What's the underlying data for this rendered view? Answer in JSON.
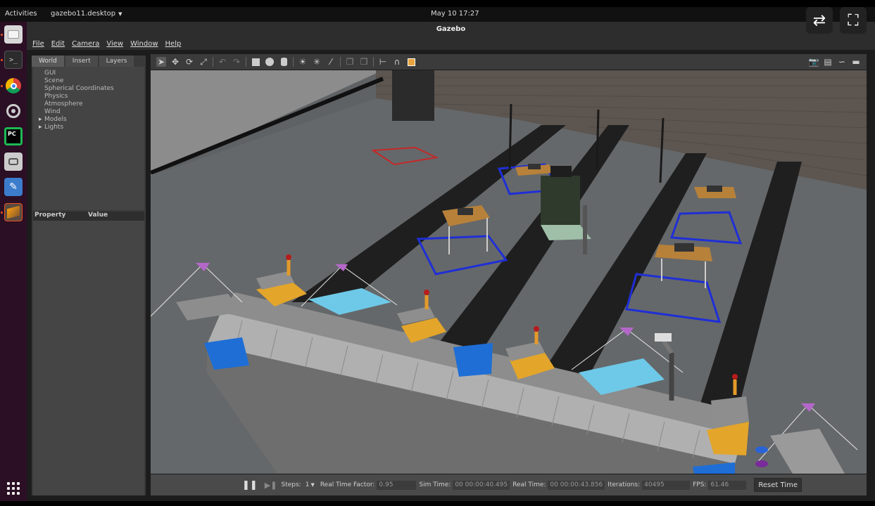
{
  "topbar": {
    "activities": "Activities",
    "app_menu": "gazebo11.desktop",
    "clock": "May 10  17:27"
  },
  "window": {
    "title": "Gazebo"
  },
  "menu": {
    "items": [
      "File",
      "Edit",
      "Camera",
      "View",
      "Window",
      "Help"
    ]
  },
  "left_panel": {
    "tabs": [
      "World",
      "Insert",
      "Layers"
    ],
    "active_tab": "World",
    "tree": [
      "GUI",
      "Scene",
      "Spherical Coordinates",
      "Physics",
      "Atmosphere",
      "Wind",
      "Models",
      "Lights"
    ],
    "property_header": "Property",
    "value_header": "Value"
  },
  "bottombar": {
    "steps_label": "Steps:",
    "steps_value": "1",
    "rtf_label": "Real Time Factor:",
    "rtf_value": "0.95",
    "sim_time_label": "Sim Time:",
    "sim_time_value": "00 00:00:40.495",
    "real_time_label": "Real Time:",
    "real_time_value": "00 00:00:43.856",
    "iterations_label": "Iterations:",
    "iterations_value": "40495",
    "fps_label": "FPS:",
    "fps_value": "61.46",
    "reset_label": "Reset Time"
  },
  "colors": {
    "dock_bg": "#2b0f24",
    "accent": "#e95420",
    "panel_bg": "#3a3a3a",
    "viewport_floor": "#5f6264"
  },
  "icons": {
    "toolbar": [
      "select-arrow-icon",
      "translate-icon",
      "rotate-icon",
      "scale-icon",
      "undo-icon",
      "redo-icon",
      "box-icon",
      "sphere-icon",
      "cylinder-icon",
      "point-light-icon",
      "spot-light-icon",
      "directional-light-icon",
      "copy-icon",
      "paste-icon",
      "align-icon",
      "snap-icon",
      "view-angle-icon"
    ],
    "toolbar_right": [
      "screenshot-icon",
      "log-icon",
      "plot-icon",
      "record-icon"
    ]
  }
}
